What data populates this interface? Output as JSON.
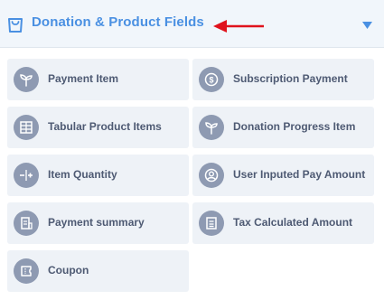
{
  "header": {
    "title": "Donation & Product Fields",
    "icon": "shopping-bag-icon",
    "collapse_icon": "caret-down-icon",
    "accent_color": "#4a90e2"
  },
  "fields": [
    {
      "label": "Payment Item",
      "icon": "sprout-icon"
    },
    {
      "label": "Subscription Payment",
      "icon": "dollar-circle-icon"
    },
    {
      "label": "Tabular Product Items",
      "icon": "table-icon"
    },
    {
      "label": "Donation Progress Item",
      "icon": "sprout-icon"
    },
    {
      "label": "Item Quantity",
      "icon": "quantity-stepper-icon"
    },
    {
      "label": "User Inputed Pay Amount",
      "icon": "user-circle-icon"
    },
    {
      "label": "Payment summary",
      "icon": "receipt-icon"
    },
    {
      "label": "Tax Calculated Amount",
      "icon": "calculator-icon"
    },
    {
      "label": "Coupon",
      "icon": "ticket-icon"
    }
  ],
  "annotation_color": "#e0121c"
}
